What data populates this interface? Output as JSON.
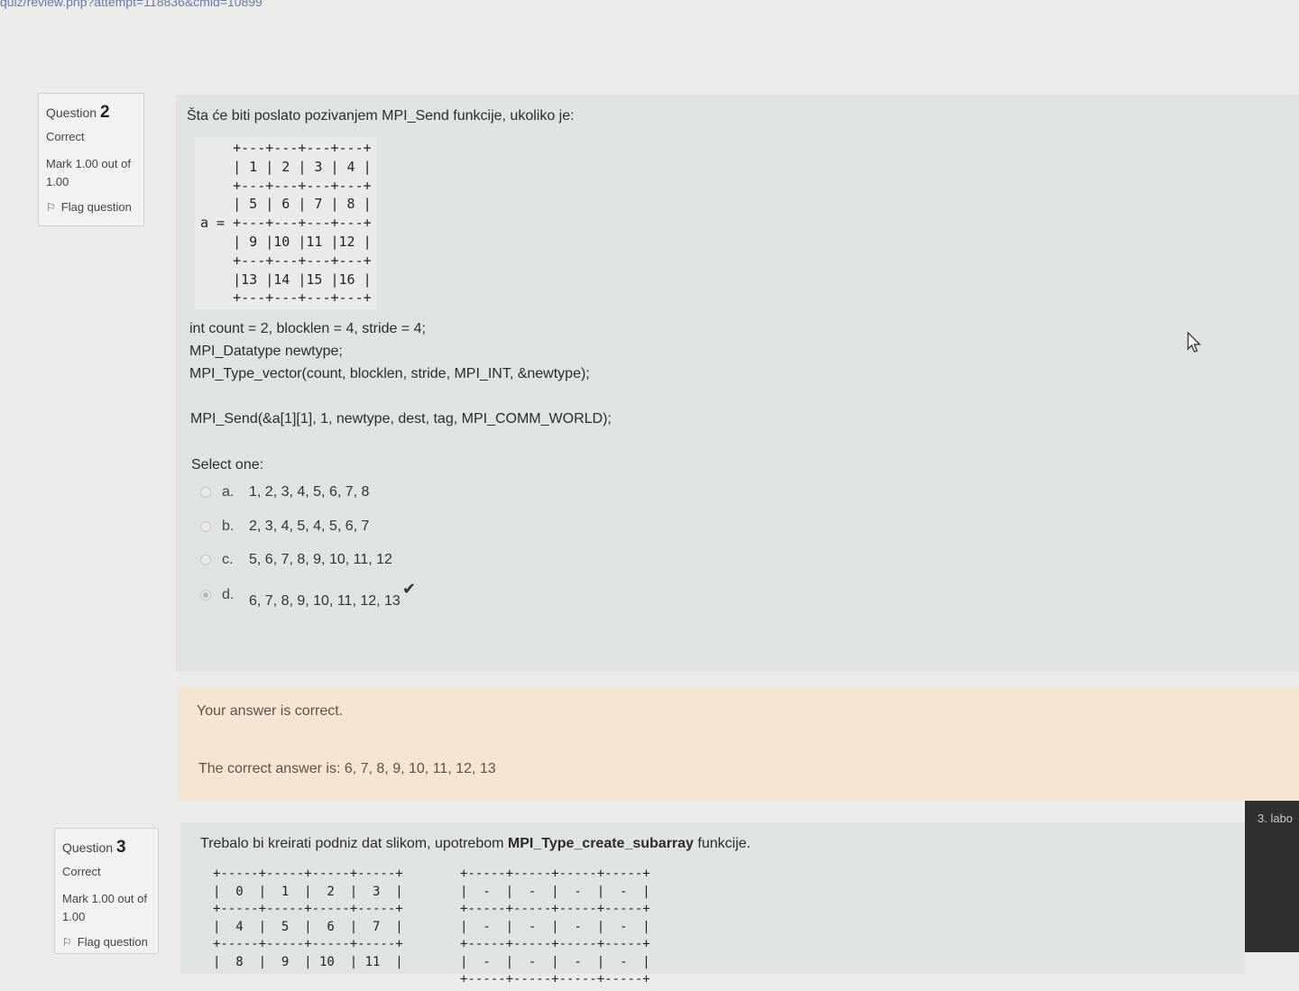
{
  "browser": {
    "url_fragment": "quiz/review.php?attempt=118836&cmid=10899"
  },
  "question2": {
    "label": "Question",
    "number": "2",
    "state": "Correct",
    "grade": "Mark 1.00 out of 1.00",
    "flag_label": "Flag question",
    "text": "Šta će biti poslato pozivanjem MPI_Send funkcije, ukoliko je:",
    "matrix": "    +---+---+---+---+\n    | 1 | 2 | 3 | 4 |\n    +---+---+---+---+\n    | 5 | 6 | 7 | 8 |\na = +---+---+---+---+\n    | 9 |10 |11 |12 |\n    +---+---+---+---+\n    |13 |14 |15 |16 |\n    +---+---+---+---+",
    "code": {
      "line1": "int count = 2, blocklen = 4, stride = 4;",
      "line2": "MPI_Datatype newtype;",
      "line3": "MPI_Type_vector(count, blocklen, stride, MPI_INT, &newtype);",
      "line4": "MPI_Send(&a[1][1], 1, newtype, dest, tag, MPI_COMM_WORLD);"
    },
    "select_prompt": "Select one:",
    "answers": [
      {
        "letter": "a.",
        "text": "1, 2, 3, 4, 5, 6, 7, 8",
        "checked": false
      },
      {
        "letter": "b.",
        "text": "2, 3, 4, 5, 4, 5, 6, 7",
        "checked": false
      },
      {
        "letter": "c.",
        "text": "5, 6, 7, 8, 9, 10, 11, 12",
        "checked": false
      },
      {
        "letter": "d.",
        "text": "6, 7, 8, 9, 10, 11, 12, 13",
        "checked": true
      }
    ],
    "feedback": "Your answer is correct.",
    "right_answer": "The correct answer is: 6, 7, 8, 9, 10, 11, 12, 13"
  },
  "question3": {
    "label": "Question",
    "number": "3",
    "state": "Correct",
    "grade": "Mark 1.00 out of 1.00",
    "flag_label": "Flag question",
    "text_before": "Trebalo bi kreirati podniz dat slikom, upotrebom ",
    "text_bold": "MPI_Type_create_subarray",
    "text_after": " funkcije.",
    "matrix_left": "+-----+-----+-----+-----+\n|  0  |  1  |  2  |  3  |\n+-----+-----+-----+-----+\n|  4  |  5  |  6  |  7  |\n+-----+-----+-----+-----+\n|  8  |  9  | 10  | 11  |",
    "matrix_right": "+-----+-----+-----+-----+\n|  -  |  -  |  -  |  -  |\n+-----+-----+-----+-----+\n|  -  |  -  |  -  |  -  |\n+-----+-----+-----+-----+\n|  -  |  -  |  -  |  -  |\n+-----+-----+-----+-----+"
  },
  "side_panel": {
    "label": "3. labo"
  }
}
